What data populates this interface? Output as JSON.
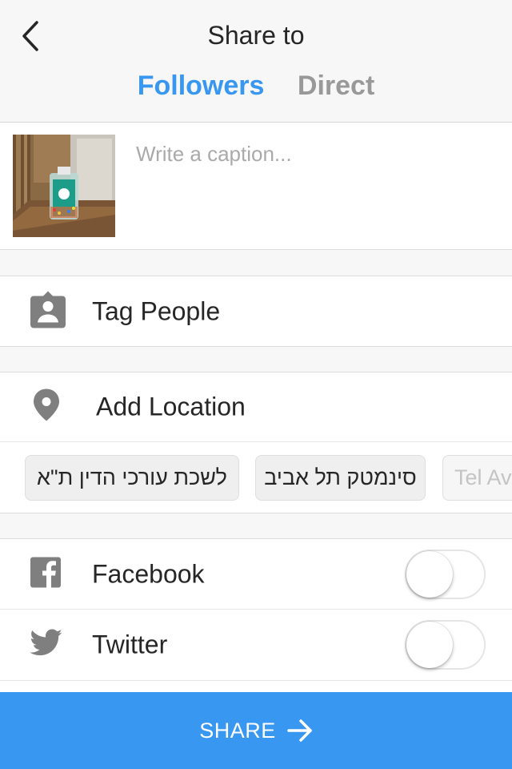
{
  "header": {
    "title": "Share to",
    "back_icon": "chevron-left-icon",
    "tabs": [
      {
        "label": "Followers",
        "active": true
      },
      {
        "label": "Direct",
        "active": false
      }
    ]
  },
  "caption": {
    "placeholder": "Write a caption...",
    "value": ""
  },
  "options": {
    "tag_people": {
      "label": "Tag People",
      "icon": "tag-person-icon"
    },
    "add_location": {
      "label": "Add Location",
      "icon": "location-pin-icon"
    }
  },
  "location_suggestions": [
    "לשכת עורכי הדין ת\"א",
    "סינמטק תל אביב",
    "Tel Av"
  ],
  "share_targets": [
    {
      "label": "Facebook",
      "icon": "facebook-icon",
      "enabled": false
    },
    {
      "label": "Twitter",
      "icon": "twitter-icon",
      "enabled": false
    }
  ],
  "share_button": {
    "label": "SHARE",
    "icon": "arrow-right-icon"
  },
  "colors": {
    "accent": "#3897f0",
    "inactive_tab": "#999999",
    "icon_gray": "#7f7f7f"
  }
}
